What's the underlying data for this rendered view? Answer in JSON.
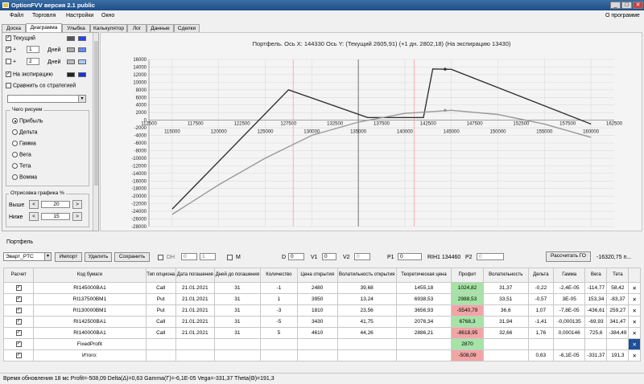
{
  "window": {
    "title": "OptionFVV версия 2.1 public",
    "min": "_",
    "max": "□",
    "close": "✕"
  },
  "menu": {
    "items": [
      "Файл",
      "Торговля",
      "Настройки",
      "Окно"
    ],
    "about": "О программе"
  },
  "tabs": [
    "Доска",
    "Диаграмма",
    "Улыбка",
    "Калькулятор",
    "Лог",
    "Данные",
    "Сделки"
  ],
  "left": {
    "current": "Текущий",
    "plus1": "+",
    "days1": "1",
    "days_label1": "Дней",
    "plus2": "+",
    "days2": "2",
    "days_label2": "Дней",
    "expiry": "На экспирацию",
    "compare": "Сравнить со стратегией",
    "what_draw": "Чего рисуем",
    "radios": [
      "Прибыль",
      "Дельта",
      "Гамма",
      "Вега",
      "Тета",
      "Вомма"
    ],
    "range_title": "Отрисовка графика %",
    "above": "Выше",
    "above_val": "20",
    "below": "Ниже",
    "below_val": "15",
    "btn_left": "<",
    "btn_right": ">",
    "colors": {
      "current": [
        "#555555",
        "#2244ee"
      ],
      "plus1": [
        "#aaaaaa",
        "#6688ff"
      ],
      "plus2": [
        "#bbbbbb",
        "#aaccff"
      ],
      "expiry": [
        "#222222",
        "#1133dd"
      ]
    }
  },
  "chart_data": {
    "type": "line",
    "title": "Портфель. Ось X: 144330 Ось Y: (Текущий 2605,91) (+1 дн. 2802,18) (На экспирацию 13430)",
    "xlim": [
      112500,
      162500
    ],
    "ylim": [
      -28000,
      16000
    ],
    "x_ticks_top": [
      "112500",
      "117500",
      "122500",
      "127500",
      "132500",
      "137500",
      "142500",
      "147500",
      "152500",
      "157500",
      "162500"
    ],
    "x_ticks_bottom": [
      "115000",
      "120000",
      "125000",
      "130000",
      "135000",
      "140000",
      "145000",
      "150000",
      "155000",
      "160000"
    ],
    "y_ticks": [
      "16000",
      "14000",
      "12000",
      "10000",
      "8000",
      "6000",
      "4000",
      "2000",
      "0",
      "-2000",
      "-4000",
      "-6000",
      "-8000",
      "-10000",
      "-12000",
      "-14000",
      "-16000",
      "-18000",
      "-20000",
      "-22000",
      "-24000",
      "-26000",
      "-28000"
    ],
    "series": [
      {
        "color": "#333333",
        "x": [
          115000,
          127500,
          136000,
          142000,
          143000,
          145000,
          160000
        ],
        "y": [
          -23400,
          8000,
          700,
          700,
          13500,
          13400,
          -1000
        ]
      },
      {
        "color": "#999999",
        "x": [
          115000,
          120000,
          125000,
          130000,
          135000,
          140000,
          145000,
          150000,
          155000,
          160000
        ],
        "y": [
          -24800,
          -17000,
          -10000,
          -4000,
          -500,
          1800,
          2600,
          1500,
          -1000,
          -4500
        ]
      }
    ],
    "vlines": [
      {
        "x": 128000,
        "color": "#ff9aa8"
      },
      {
        "x": 141000,
        "color": "#ff9aa8"
      },
      {
        "x": 135000,
        "color": "#555555"
      }
    ],
    "markers": [
      {
        "x": 144330,
        "y": 13430,
        "color": "#333333"
      },
      {
        "x": 144330,
        "y": 2606,
        "color": "#999999"
      }
    ]
  },
  "portfolio": {
    "label": "Портфель",
    "account": "Эварт_PTC",
    "import": "Импорт",
    "delete": "Удалить",
    "save": "Сохранить",
    "dh": "DH",
    "dh_v1": "0",
    "dh_v2": "1",
    "m": "M",
    "d_label": "D",
    "d_val": "0",
    "v1_label": "V1",
    "v1_val": "0",
    "v2_label": "V2",
    "v2_val": "0",
    "p1_label": "P1",
    "p1_val": "0",
    "rih": "RIH1 134460",
    "p2_label": "P2",
    "p2_val": "0",
    "calc_go": "Рассчитать ГО",
    "go_val": "-16320,75 п..."
  },
  "table": {
    "headers": [
      "Расчет",
      "Код бумаги",
      "Тип опциона",
      "Дата погашения",
      "Дней до погашения",
      "Количество",
      "Цена открытия",
      "Волатильность открытия",
      "Теоретическая цена",
      "Профит",
      "Волатильность",
      "Дельта",
      "Гамма",
      "Вега",
      "Тета",
      ""
    ],
    "rows": [
      [
        "✓",
        "RI145000BA1",
        "Call",
        "21.01.2021",
        "31",
        "-1",
        "2480",
        "39,68",
        "1455,18",
        "1024,82",
        "31,37",
        "-0,22",
        "-2,4E-05",
        "-114,77",
        "58,42",
        "✕"
      ],
      [
        "✓",
        "RI137500BM1",
        "Put",
        "21.01.2021",
        "31",
        "1",
        "3950",
        "13,24",
        "6938,53",
        "2988,53",
        "33,51",
        "-0,57",
        "3E-05",
        "153,34",
        "-83,37",
        "✕"
      ],
      [
        "✓",
        "RI130000BM1",
        "Put",
        "21.01.2021",
        "31",
        "-3",
        "1810",
        "23,56",
        "3656,93",
        "-5540,79",
        "36,6",
        "1,07",
        "-7,8E-05",
        "-436,61",
        "259,27",
        "✕"
      ],
      [
        "✓",
        "RI142500BA1",
        "Call",
        "21.01.2021",
        "31",
        "-5",
        "3430",
        "41,75",
        "2076,34",
        "6768,3",
        "31,94",
        "-1,41",
        "-0,000135",
        "-69,93",
        "341,47",
        "✕"
      ],
      [
        "✓",
        "RI140000BA1",
        "Call",
        "21.01.2021",
        "31",
        "5",
        "4610",
        "44,26",
        "2886,21",
        "-8618,95",
        "32,66",
        "1,76",
        "0,000146",
        "725,6",
        "-384,49",
        "✕"
      ]
    ],
    "fixed_label": "FixedProfit",
    "fixed_val": "2870",
    "total_label": "Итого:",
    "total_profit": "-508,09",
    "total_delta": "0,63",
    "total_gamma": "-6,1E-05",
    "total_vega": "-331,37",
    "total_theta": "191,3"
  },
  "status": "Время обновления 18 мс  Profit=-508,09 Delta(Δ)=0,63 Gamma(Γ)=-6,1E-05 Vega=-331,37 Theta(Θ)=191,3"
}
